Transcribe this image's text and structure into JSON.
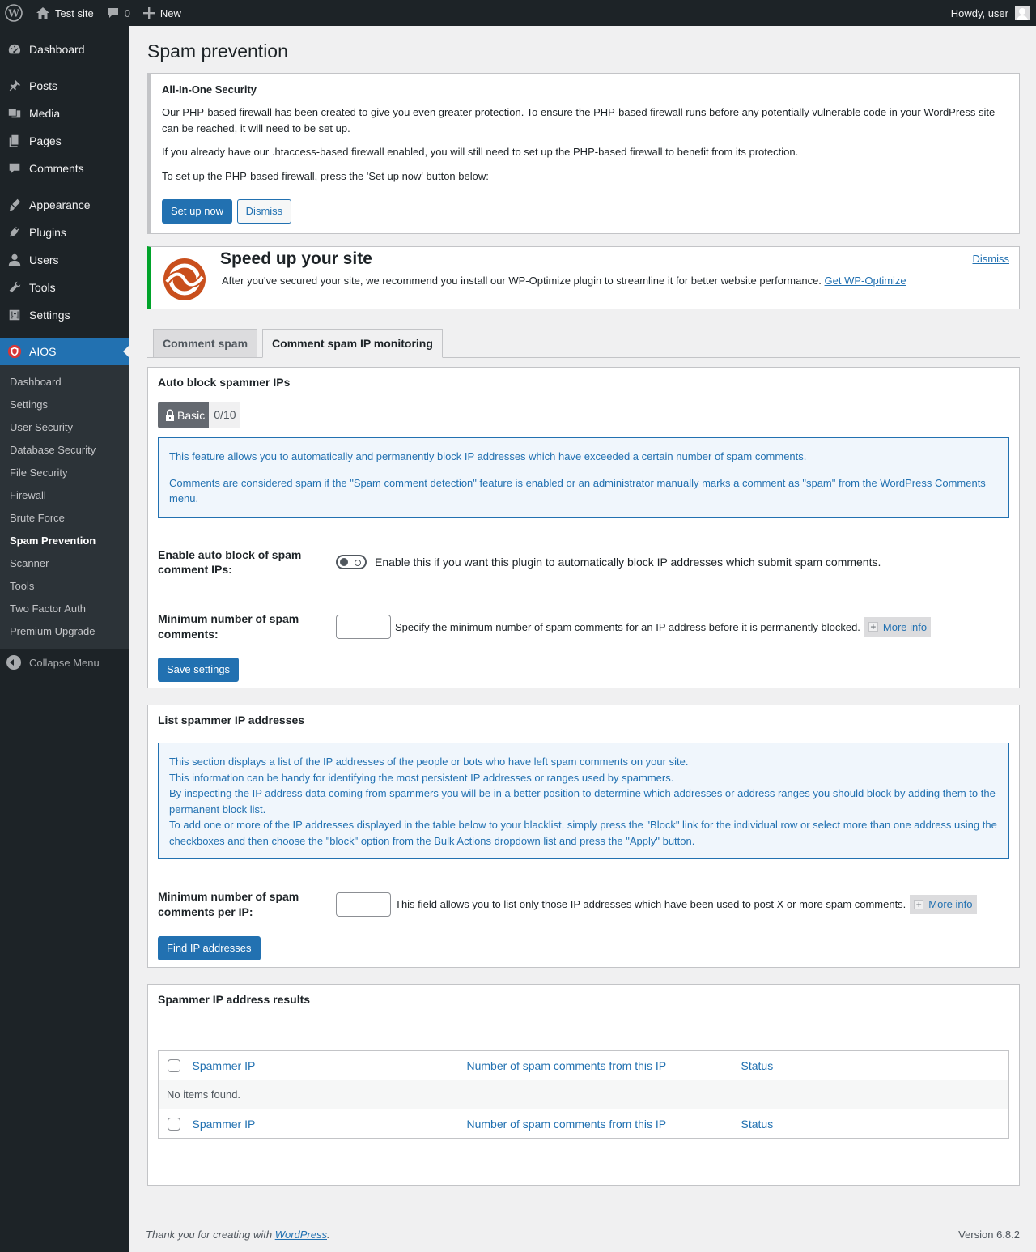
{
  "adminbar": {
    "site_name": "Test site",
    "comments_count": "0",
    "new_label": "New",
    "howdy": "Howdy, user"
  },
  "sidebar": {
    "menu": [
      "Dashboard",
      "Posts",
      "Media",
      "Pages",
      "Comments",
      "Appearance",
      "Plugins",
      "Users",
      "Tools",
      "Settings"
    ],
    "aios_label": "AIOS",
    "submenu": [
      "Dashboard",
      "Settings",
      "User Security",
      "Database Security",
      "File Security",
      "Firewall",
      "Brute Force",
      "Spam Prevention",
      "Scanner",
      "Tools",
      "Two Factor Auth",
      "Premium Upgrade"
    ],
    "current_submenu": "Spam Prevention",
    "collapse_label": "Collapse Menu"
  },
  "page": {
    "title": "Spam prevention"
  },
  "firewall_notice": {
    "title": "All-In-One Security",
    "p1": "Our PHP-based firewall has been created to give you even greater protection. To ensure the PHP-based firewall runs before any potentially vulnerable code in your WordPress site can be reached, it will need to be set up.",
    "p2": "If you already have our .htaccess-based firewall enabled, you will still need to set up the PHP-based firewall to benefit from its protection.",
    "p3": "To set up the PHP-based firewall, press the 'Set up now' button below:",
    "setup_button": "Set up now",
    "dismiss_button": "Dismiss"
  },
  "optimize_notice": {
    "title": "Speed up your site",
    "text": "After you've secured your site, we recommend you install our WP-Optimize plugin to streamline it for better website performance.",
    "link": "Get WP-Optimize",
    "dismiss": "Dismiss"
  },
  "tabs": [
    "Comment spam",
    "Comment spam IP monitoring"
  ],
  "auto_block": {
    "title": "Auto block spammer IPs",
    "badge_label": "Basic",
    "badge_score": "0/10",
    "info_p1": "This feature allows you to automatically and permanently block IP addresses which have exceeded a certain number of spam comments.",
    "info_p2": "Comments are considered spam if the \"Spam comment detection\" feature is enabled or an administrator manually marks a comment as \"spam\" from the WordPress Comments menu.",
    "enable_label": "Enable auto block of spam comment IPs:",
    "enable_desc": "Enable this if you want this plugin to automatically block IP addresses which submit spam comments.",
    "min_label": "Minimum number of spam comments:",
    "min_value": "",
    "min_desc": "Specify the minimum number of spam comments for an IP address before it is permanently blocked.",
    "more_info": "More info",
    "save_button": "Save settings"
  },
  "list_spammer": {
    "title": "List spammer IP addresses",
    "info_lines": [
      "This section displays a list of the IP addresses of the people or bots who have left spam comments on your site.",
      "This information can be handy for identifying the most persistent IP addresses or ranges used by spammers.",
      "By inspecting the IP address data coming from spammers you will be in a better position to determine which addresses or address ranges you should block by adding them to the permanent block list.",
      "To add one or more of the IP addresses displayed in the table below to your blacklist, simply press the \"Block\" link for the individual row or select more than one address using the checkboxes and then choose the \"block\" option from the Bulk Actions dropdown list and press the \"Apply\" button."
    ],
    "min_label": "Minimum number of spam comments per IP:",
    "min_value": "",
    "min_desc": "This field allows you to list only those IP addresses which have been used to post X or more spam comments.",
    "more_info": "More info",
    "find_button": "Find IP addresses"
  },
  "results": {
    "title": "Spammer IP address results",
    "columns": [
      "Spammer IP",
      "Number of spam comments from this IP",
      "Status"
    ],
    "empty": "No items found."
  },
  "footer": {
    "thanks_prefix": "Thank you for creating with",
    "thanks_link": "WordPress",
    "thanks_suffix": ".",
    "version": "Version 6.8.2"
  },
  "colors": {
    "admin_dark": "#1d2327",
    "primary": "#2271b1",
    "success": "#00a32a",
    "aios_red": "#d63638",
    "optimize_orange": "#c94f1d"
  }
}
